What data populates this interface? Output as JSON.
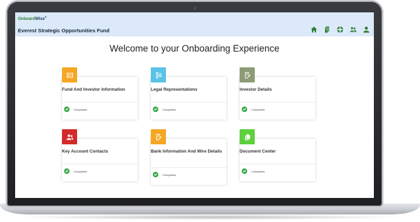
{
  "app": {
    "brand_on": "Onboard",
    "brand_wise": "Wise",
    "brand_mark": "®",
    "fund_name": "Everest Strategic Opportunities Fund"
  },
  "nav": [
    {
      "icon": "home-icon"
    },
    {
      "icon": "documents-icon"
    },
    {
      "icon": "support-icon"
    },
    {
      "icon": "users-icon"
    },
    {
      "icon": "profile-icon"
    }
  ],
  "page_title": "Welcome to your Onboarding Experience",
  "cards": [
    {
      "title": "Fund And Investor Information",
      "status": "Completed",
      "icon": "id-card-icon",
      "color": "#f5a623"
    },
    {
      "title": "Legal Representations",
      "status": "Completed",
      "icon": "legal-icon",
      "color": "#5bc2e7"
    },
    {
      "title": "Investor Details",
      "status": "Completed",
      "icon": "edit-form-icon",
      "color": "#8d9c76"
    },
    {
      "title": "Key Account Contacts",
      "status": "Completed",
      "icon": "contacts-icon",
      "color": "#d32a2a"
    },
    {
      "title": "Bank Information And Wire Details",
      "status": "Completed",
      "icon": "bank-form-icon",
      "color": "#f5a623"
    },
    {
      "title": "Document Center",
      "status": "Completed",
      "icon": "document-icon",
      "color": "#5fcf3c"
    }
  ],
  "colors": {
    "topbar": "#dbe9f8",
    "brand_green": "#2e7d32",
    "completed_green": "#3aa84a"
  }
}
